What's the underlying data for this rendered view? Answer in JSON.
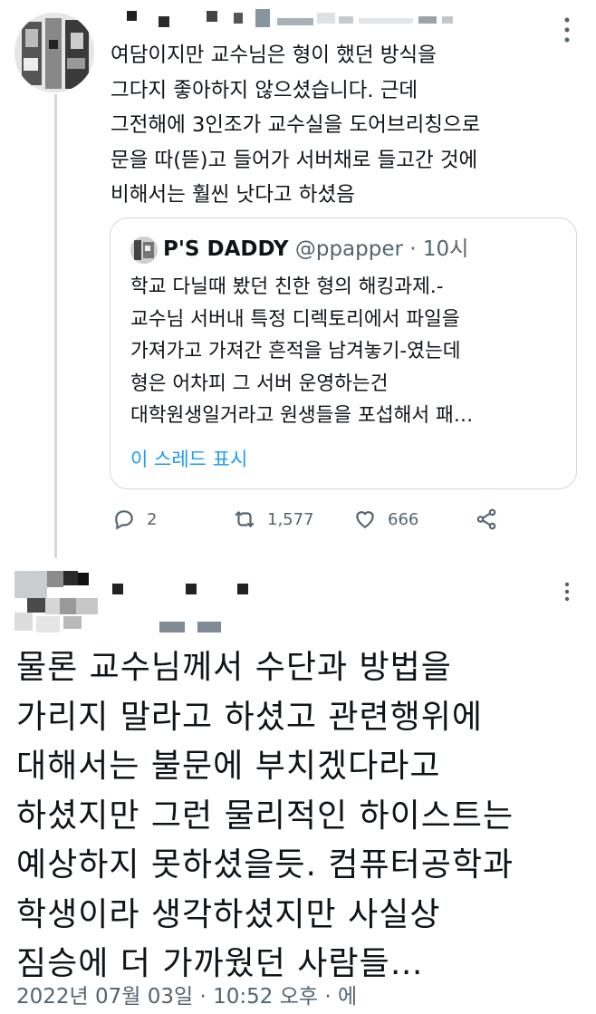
{
  "tweet1": {
    "text": "여담이지만 교수님은 형이 했던 방식을\n그다지 좋아하지 않으셨습니다. 근데\n그전해에 3인조가 교수실을 도어브리칭으로\n문을 따(뜯)고 들어가 서버채로 들고간 것에\n비해서는 훨씬 낫다고 하셨음",
    "more_icon": "more-horizontal-icon"
  },
  "quote": {
    "name": "P'S DADDY",
    "handle": "@ppapper",
    "dot": "·",
    "time": "10시",
    "text": "학교 다닐때 봤던 친한 형의 해킹과제.-\n교수님 서버내 특정 디렉토리에서 파일을\n가져가고 가져간 흔적을 남겨놓기-였는데\n형은 어차피 그 서버 운영하는건\n대학원생일거라고 원생들을 포섭해서 패…",
    "show_thread": "이 스레드 표시"
  },
  "actions": {
    "reply_count": "2",
    "retweet_count": "1,577",
    "like_count": "666",
    "reply_icon": "reply-icon",
    "retweet_icon": "retweet-icon",
    "like_icon": "heart-icon",
    "share_icon": "share-icon"
  },
  "tweet2": {
    "text": "물론 교수님께서 수단과 방법을\n가리지 말라고 하셨고 관련행위에\n대해서는 불문에 부치겠다라고\n하셨지만 그런 물리적인 하이스트는\n예상하지 못하셨을듯. 컴퓨터공학과\n학생이라 생각하셨지만 사실상\n짐승에 더 가까웠던 사람들…",
    "timestamp": "2022년 07월 03일 · 10:52 오후 · 에"
  },
  "colors": {
    "text": "#0f1419",
    "secondary": "#536471",
    "link": "#1d9bf0",
    "border": "#cfd9de"
  }
}
